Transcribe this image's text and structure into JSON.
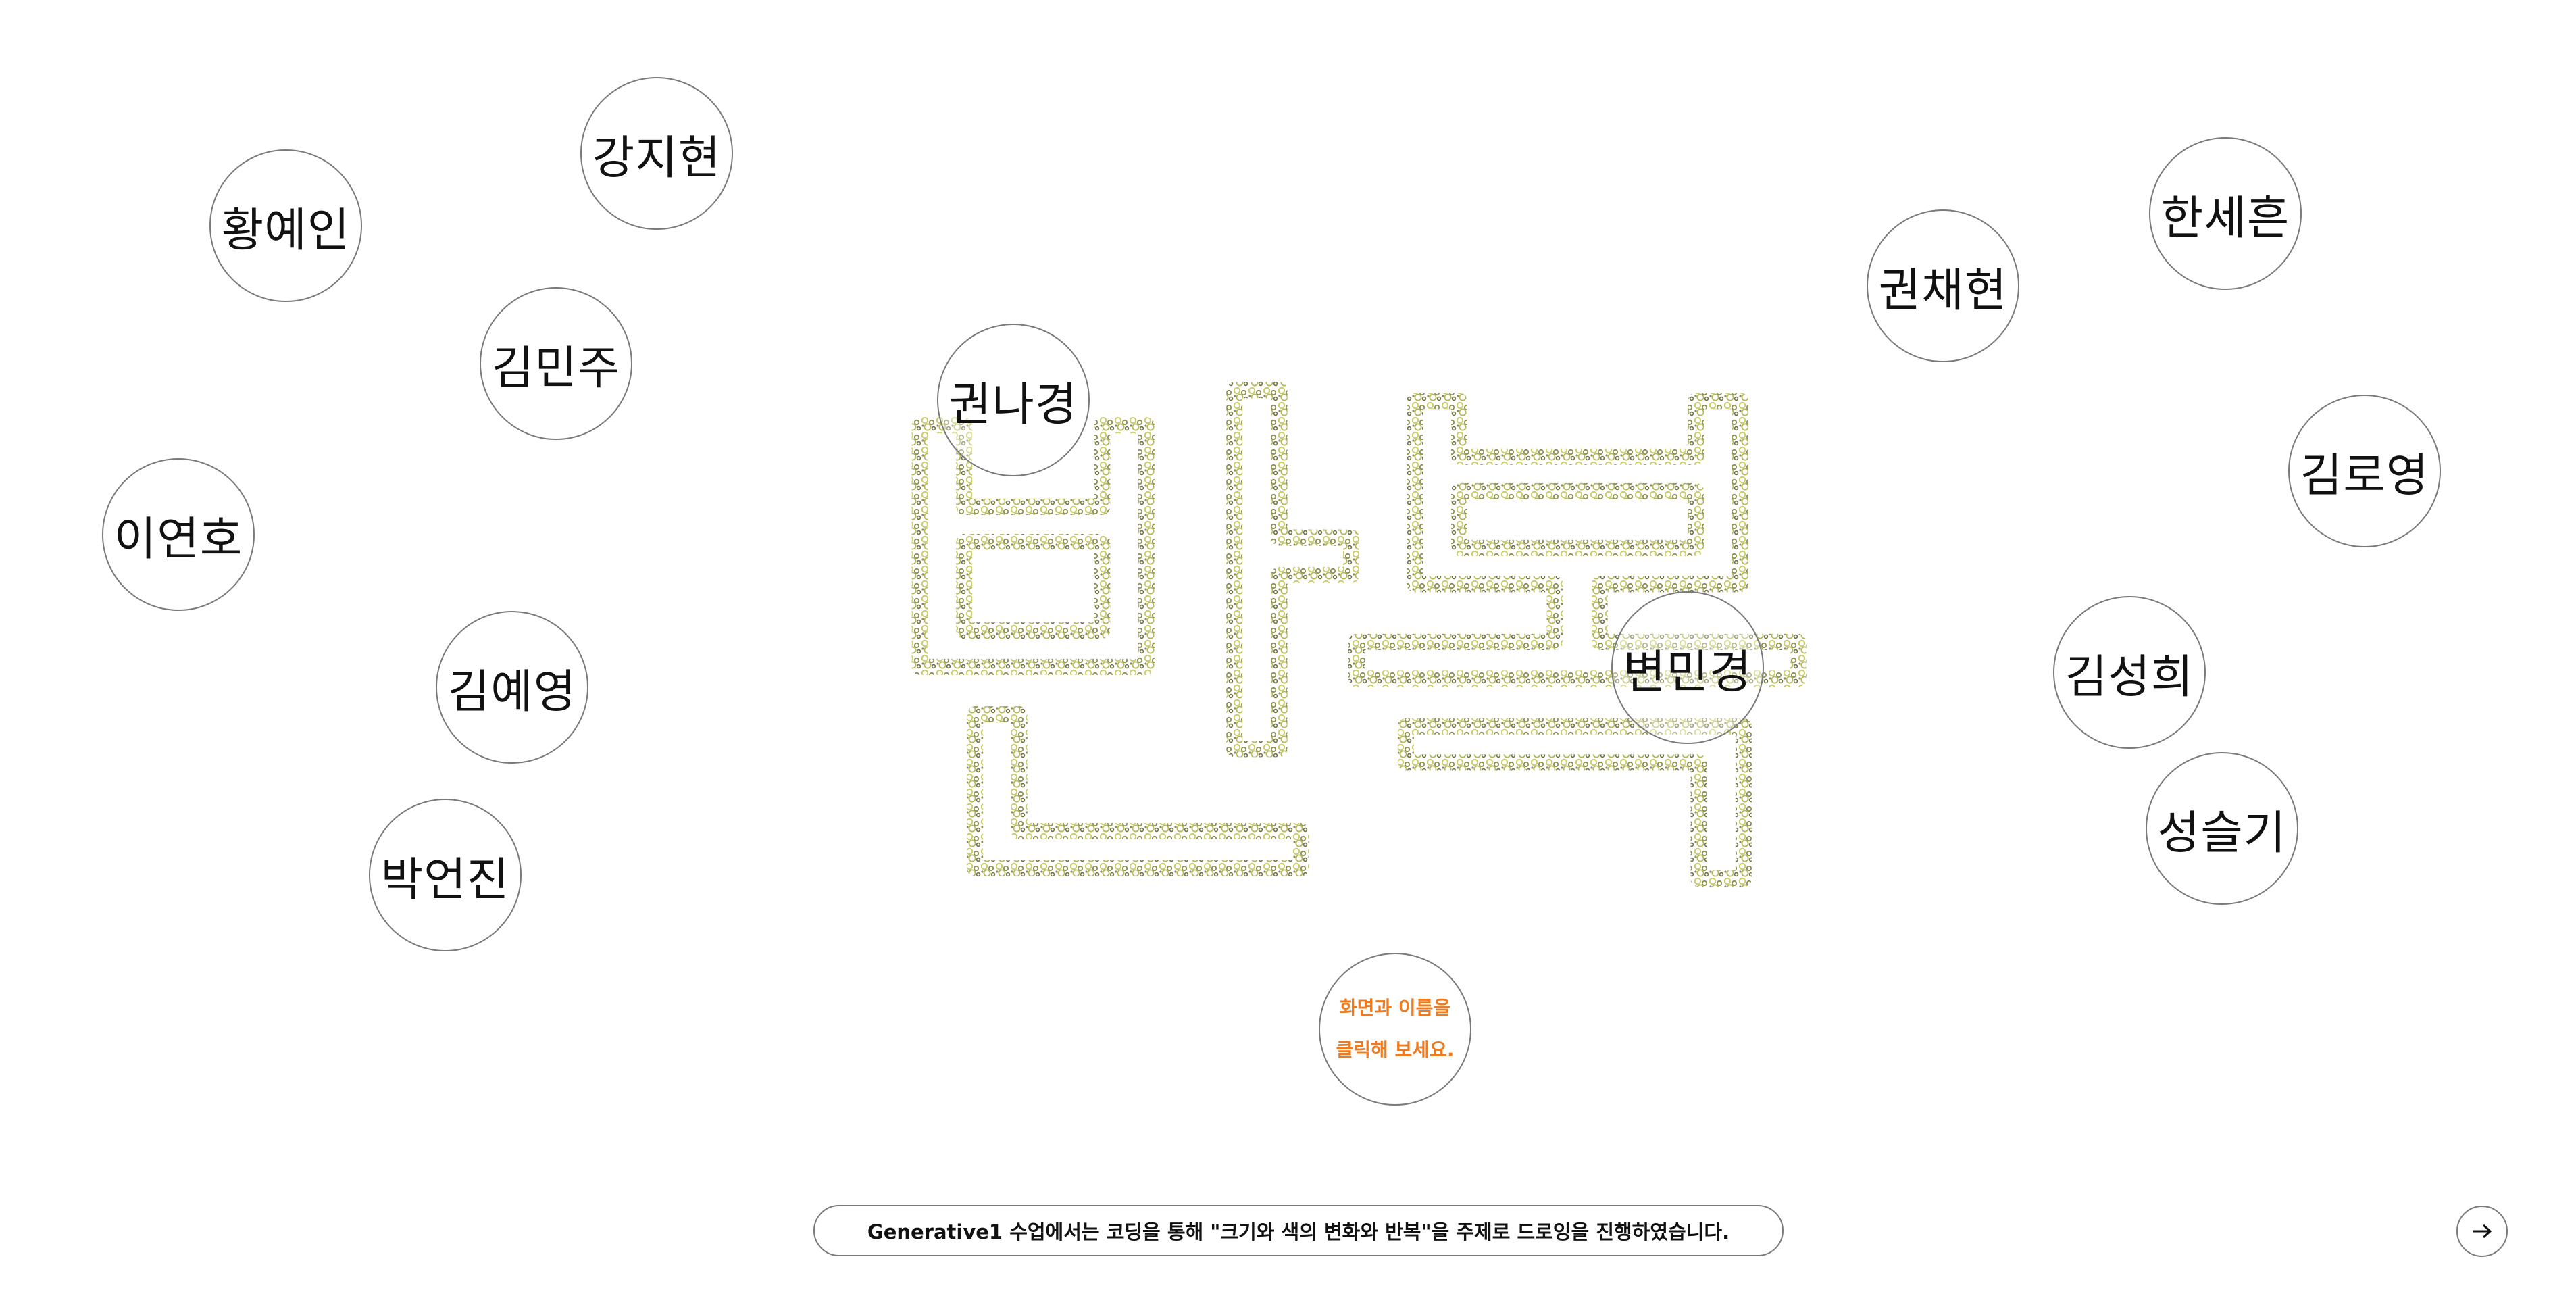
{
  "main_text": "반복",
  "names": [
    "강지현",
    "황예인",
    "김민주",
    "이연호",
    "김예영",
    "박언진",
    "권나경",
    "변민경",
    "권채현",
    "한세흔",
    "김로영",
    "김성희",
    "성슬기"
  ],
  "hint": {
    "line1": "화면과 이름을",
    "line2": "클릭해 보세요."
  },
  "caption": "Generative1 수업에서는 코딩을 통해 \"크기와 색의 변화와 반복\"을 주제로 드로잉을 진행하였습니다.",
  "next_icon": "arrow-right-icon",
  "colors": {
    "hint_text": "#f07a1e",
    "circle_stroke": "#7a7a7a",
    "dot_yellow": "#c9cc6a",
    "dot_olive": "#8c8f52",
    "dot_dark": "#6b6e3e"
  }
}
